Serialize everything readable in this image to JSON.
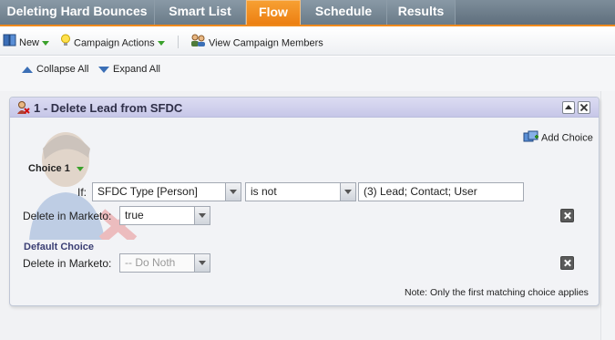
{
  "tabs": [
    {
      "label": "Deleting Hard Bounces"
    },
    {
      "label": "Smart List"
    },
    {
      "label": "Flow"
    },
    {
      "label": "Schedule"
    },
    {
      "label": "Results"
    }
  ],
  "toolbar": {
    "new_label": "New",
    "campaign_actions_label": "Campaign Actions",
    "view_members_label": "View Campaign Members"
  },
  "controls": {
    "collapse_all": "Collapse All",
    "expand_all": "Expand All"
  },
  "step": {
    "title": "1 - Delete Lead from SFDC",
    "add_choice_label": "Add Choice",
    "choice1": {
      "label": "Choice 1",
      "if_label": "If:",
      "field": "SFDC Type [Person]",
      "operator": "is not",
      "value": "(3) Lead; Contact; User",
      "delete_label": "Delete in Marketo:",
      "delete_value": "true"
    },
    "default_choice": {
      "label": "Default Choice",
      "delete_label": "Delete in Marketo:",
      "delete_value": "-- Do Noth"
    },
    "note": "Note: Only the first matching choice applies"
  },
  "colors": {
    "active_tab": "#f08a1c",
    "tab_bar": "#6a7b88",
    "panel_header": "#c7c7e8"
  }
}
